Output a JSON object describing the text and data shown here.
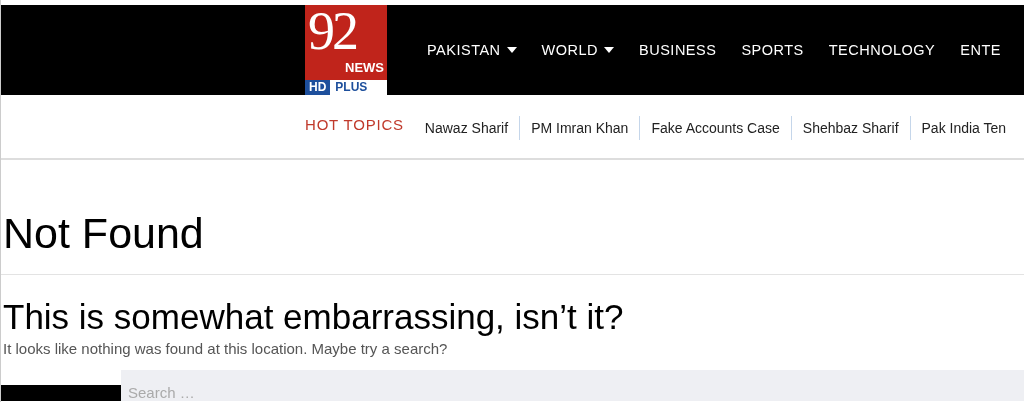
{
  "logo": {
    "number": "92",
    "word": "NEWS",
    "badge_left": "HD",
    "badge_right": "PLUS"
  },
  "nav": [
    {
      "label": "PAKISTAN",
      "dropdown": true
    },
    {
      "label": "WORLD",
      "dropdown": true
    },
    {
      "label": "BUSINESS",
      "dropdown": false
    },
    {
      "label": "SPORTS",
      "dropdown": false
    },
    {
      "label": "TECHNOLOGY",
      "dropdown": false
    },
    {
      "label": "ENTE",
      "dropdown": false
    }
  ],
  "hot_topics": {
    "title": "HOT TOPICS",
    "items": [
      "Nawaz Sharif",
      "PM Imran Khan",
      "Fake Accounts Case",
      "Shehbaz Sharif",
      "Pak India Ten"
    ]
  },
  "page_title": "Not Found",
  "heading": "This is somewhat embarrassing, isn’t it?",
  "message": "It looks like nothing was found at this location. Maybe try a search?",
  "search": {
    "placeholder": "Search …"
  }
}
